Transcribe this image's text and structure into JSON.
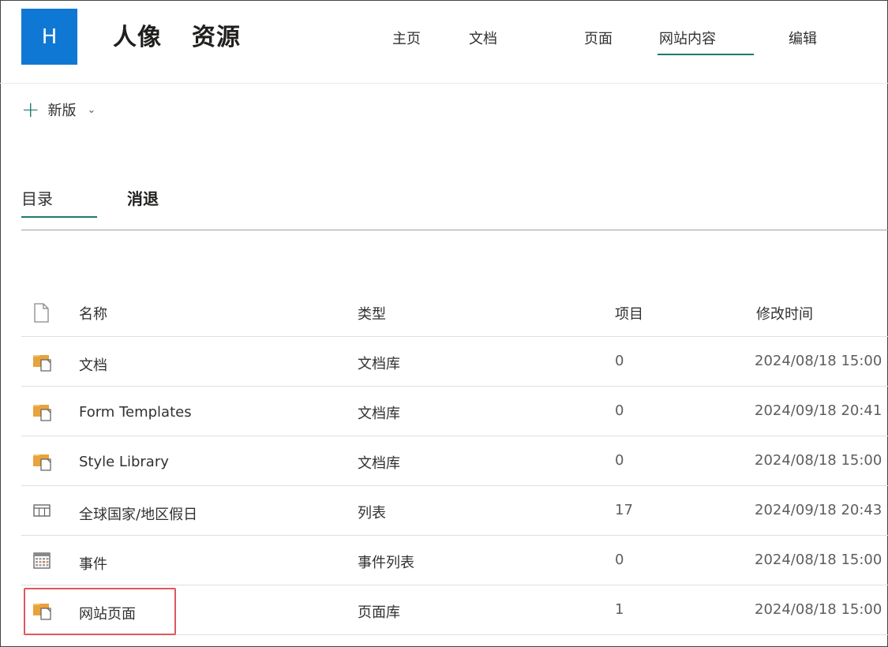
{
  "site": {
    "logo_letter": "H",
    "title_part1": "人像",
    "title_part2": "资源"
  },
  "nav": {
    "items": [
      {
        "label": "主页"
      },
      {
        "label": "文档"
      },
      {
        "label": "页面"
      },
      {
        "label": "网站内容",
        "active": true
      },
      {
        "label": "编辑"
      }
    ]
  },
  "command": {
    "new_label": "新版"
  },
  "tabs": [
    {
      "label": "目录",
      "active": true
    },
    {
      "label": "消退"
    }
  ],
  "table": {
    "columns": {
      "name": "名称",
      "type": "类型",
      "items": "项目",
      "modified": "修改时间"
    },
    "rows": [
      {
        "icon": "document-library-icon",
        "name": "文档",
        "type": "文档库",
        "items": "0",
        "modified": "2024/08/18 15:00"
      },
      {
        "icon": "document-library-icon",
        "name": "Form Templates",
        "type": "文档库",
        "items": "0",
        "modified": "2024/09/18 20:41"
      },
      {
        "icon": "document-library-icon",
        "name": "Style Library",
        "type": "文档库",
        "items": "0",
        "modified": "2024/08/18 15:00"
      },
      {
        "icon": "list-icon",
        "name": "全球国家/地区假日",
        "type": "列表",
        "items": "17",
        "modified": "2024/09/18 20:43"
      },
      {
        "icon": "calendar-icon",
        "name": "事件",
        "type": "事件列表",
        "items": "0",
        "modified": "2024/08/18 15:00"
      },
      {
        "icon": "document-library-icon",
        "name": "网站页面",
        "type": "页面库",
        "items": "1",
        "modified": "2024/08/18 15:00"
      }
    ]
  },
  "colors": {
    "accent": "#1e7a72",
    "logo_bg": "#0f78d4",
    "highlight": "#e0575b",
    "library_icon": "#e8a33b"
  }
}
